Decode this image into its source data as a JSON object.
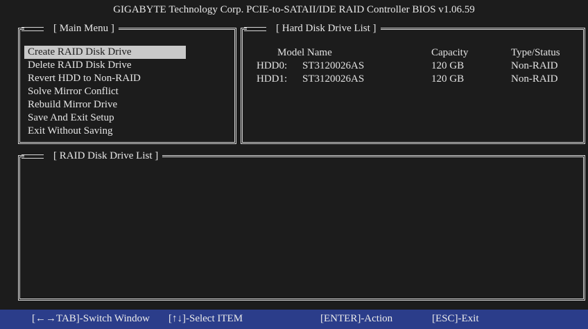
{
  "title": "GIGABYTE Technology Corp. PCIE-to-SATAII/IDE RAID Controller BIOS v1.06.59",
  "main_menu": {
    "label": "[ Main Menu ]",
    "items": [
      {
        "label": "Create RAID Disk Drive",
        "selected": true
      },
      {
        "label": "Delete RAID Disk Drive"
      },
      {
        "label": "Revert HDD to Non-RAID"
      },
      {
        "label": "Solve Mirror Conflict"
      },
      {
        "label": "Rebuild Mirror Drive"
      },
      {
        "label": "Save And Exit Setup"
      },
      {
        "label": "Exit Without Saving"
      }
    ]
  },
  "hdd_list": {
    "label": "[ Hard Disk Drive List ]",
    "headers": {
      "model": "Model Name",
      "capacity": "Capacity",
      "type": "Type/Status"
    },
    "rows": [
      {
        "id": "HDD0:",
        "model": "ST3120026AS",
        "capacity": "120 GB",
        "type": "Non-RAID"
      },
      {
        "id": "HDD1:",
        "model": "ST3120026AS",
        "capacity": "120 GB",
        "type": "Non-RAID"
      }
    ]
  },
  "raid_list": {
    "label": "[ RAID Disk Drive List ]"
  },
  "footer": {
    "switch_window": "[←→TAB]-Switch Window",
    "select_item": "[↑↓]-Select ITEM",
    "action": "[ENTER]-Action",
    "exit": "[ESC]-Exit"
  },
  "colors": {
    "background": "#1c1c1c",
    "footer_bar": "#2b3d8a",
    "selection": "#c9c9c9",
    "text": "#e6e6e6"
  }
}
